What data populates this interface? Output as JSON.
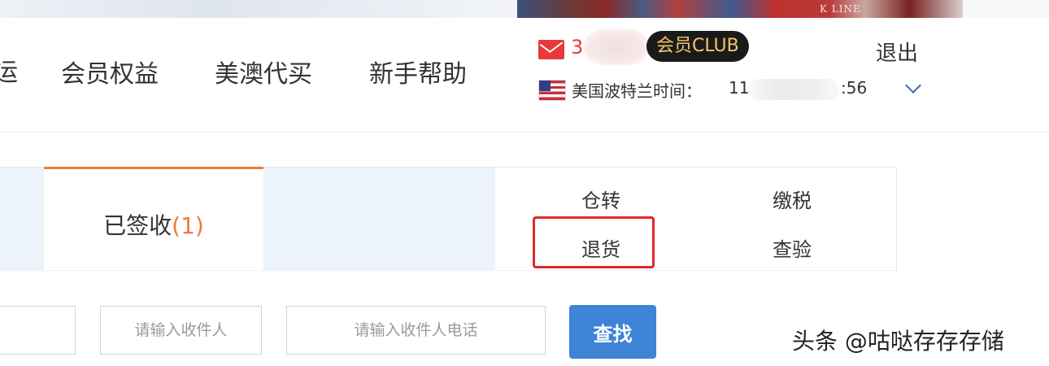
{
  "banner": {
    "photo_text": "K LINE"
  },
  "nav": {
    "partial_item": "运",
    "items": [
      "会员权益",
      "美澳代买",
      "新手帮助"
    ]
  },
  "account": {
    "user_partial": "3",
    "club_badge": "会员CLUB",
    "logout": "退出",
    "time_label": "美国波特兰时间：",
    "time_start": "11",
    "time_end": ":56"
  },
  "tabs": {
    "signed_label": "已签收",
    "signed_count": "(1)"
  },
  "operations": {
    "transfer": "仓转",
    "pay_tax": "缴税",
    "return": "退货",
    "inspect": "查验"
  },
  "search": {
    "recipient_placeholder": "请输入收件人",
    "phone_placeholder": "请输入收件人电话",
    "button": "查找"
  },
  "watermark": "头条 @咕哒存存存储",
  "colors": {
    "accent_orange": "#f07a3a",
    "primary_blue": "#3f83d6",
    "highlight_red": "#e0282e",
    "mail_red": "#e83a3a",
    "badge_bg": "#1a1a1a",
    "badge_text": "#f4c56a"
  }
}
